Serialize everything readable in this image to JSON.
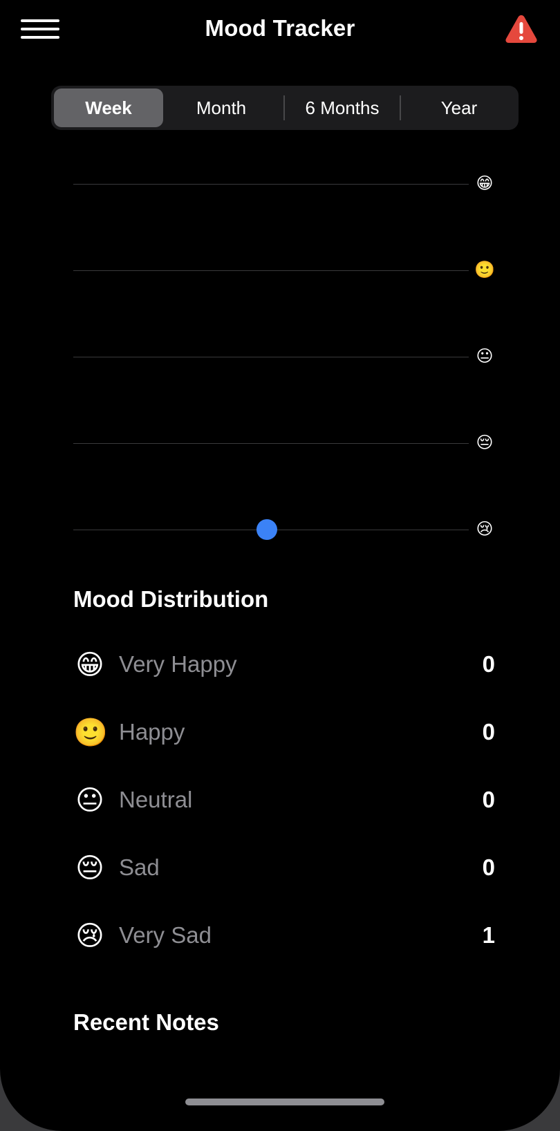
{
  "header": {
    "title": "Mood Tracker",
    "menu_icon": "hamburger-menu-icon",
    "alert_icon": "warning-triangle-icon",
    "alert_color": "#e5483d"
  },
  "range_tabs": [
    {
      "label": "Week",
      "selected": true
    },
    {
      "label": "Month",
      "selected": false
    },
    {
      "label": "6 Months",
      "selected": false
    },
    {
      "label": "Year",
      "selected": false
    }
  ],
  "chart_data": {
    "type": "scatter",
    "y_labels": [
      "😁",
      "🙂",
      "😐",
      "😔",
      "😢"
    ],
    "y_levels": [
      "Very Happy",
      "Happy",
      "Neutral",
      "Sad",
      "Very Sad"
    ],
    "points": [
      {
        "x_fraction": 0.49,
        "level": "Very Sad"
      }
    ],
    "point_color": "#3b82f6",
    "grid": true
  },
  "distribution": {
    "title": "Mood Distribution",
    "items": [
      {
        "emoji": "😁",
        "label": "Very Happy",
        "count": "0"
      },
      {
        "emoji": "🙂",
        "label": "Happy",
        "count": "0"
      },
      {
        "emoji": "😐",
        "label": "Neutral",
        "count": "0"
      },
      {
        "emoji": "😔",
        "label": "Sad",
        "count": "0"
      },
      {
        "emoji": "😢",
        "label": "Very Sad",
        "count": "1"
      }
    ]
  },
  "recent_notes": {
    "title": "Recent Notes"
  }
}
